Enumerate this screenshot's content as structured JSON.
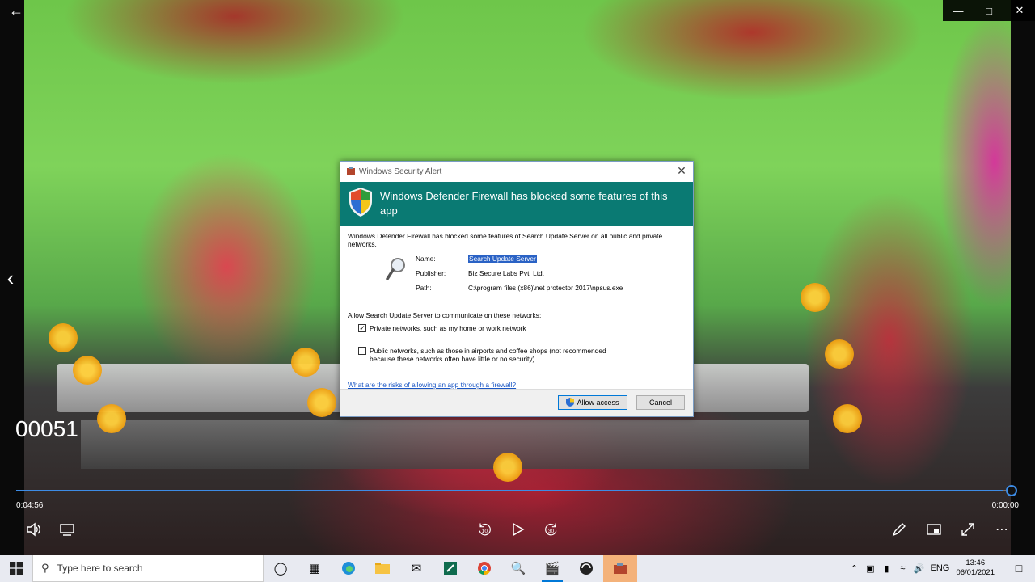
{
  "player": {
    "overlay_text": "00051",
    "time_elapsed": "0:04:56",
    "time_total": "0:00:00",
    "progress_fraction": 0.99,
    "accent": "#3d8ce6",
    "rewind_label": "10",
    "forward_label": "30"
  },
  "dialog": {
    "window_title": "Windows Security Alert",
    "headline": "Windows Defender Firewall has blocked some features of this app",
    "description": "Windows Defender Firewall has blocked some features of Search Update Server on all public and private networks.",
    "name_label": "Name:",
    "name_value": "Search Update Server",
    "publisher_label": "Publisher:",
    "publisher_value": "Biz Secure Labs Pvt. Ltd.",
    "path_label": "Path:",
    "path_value": "C:\\program files (x86)\\net protector 2017\\npsus.exe",
    "allow_prompt": "Allow Search Update Server to communicate on these networks:",
    "private_label": "Private networks, such as my home or work network",
    "private_checked": true,
    "public_label": "Public networks, such as those in airports and coffee shops (not recommended because these networks often have little or no security)",
    "public_checked": false,
    "risk_link": "What are the risks of allowing an app through a firewall?",
    "allow_button": "Allow access",
    "cancel_button": "Cancel",
    "banner_color": "#0a7a73"
  },
  "taskbar": {
    "search_placeholder": "Type here to search",
    "language": "ENG",
    "time": "13:46",
    "date": "06/01/2021",
    "highlight_color": "#f4b27a"
  }
}
